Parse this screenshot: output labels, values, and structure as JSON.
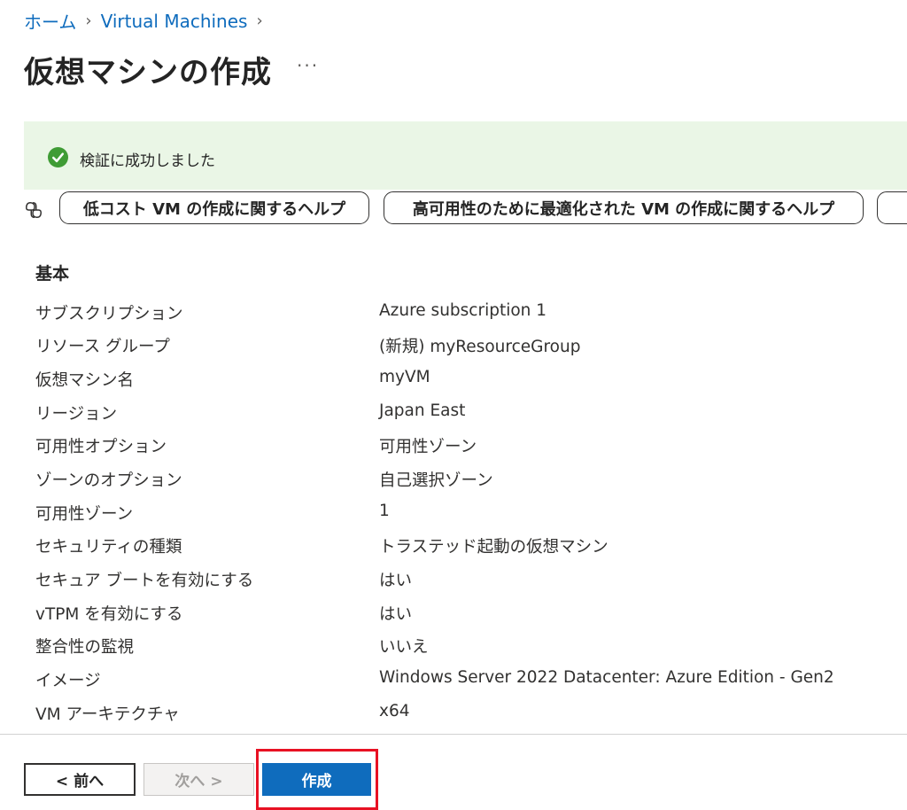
{
  "breadcrumb": {
    "home": "ホーム",
    "vms": "Virtual Machines"
  },
  "page": {
    "title": "仮想マシンの作成"
  },
  "validation": {
    "message": "検証に成功しました",
    "color": "#3f9c35"
  },
  "help_pills": [
    {
      "label": "低コスト VM の作成に関するヘルプ"
    },
    {
      "label": "高可用性のために最適化された VM の作成に関するヘルプ"
    },
    {
      "label": ""
    }
  ],
  "summary": {
    "section_title": "基本",
    "rows": [
      {
        "label": "サブスクリプション",
        "value": "Azure subscription 1"
      },
      {
        "label": "リソース グループ",
        "value": "(新規) myResourceGroup"
      },
      {
        "label": "仮想マシン名",
        "value": "myVM"
      },
      {
        "label": "リージョン",
        "value": "Japan East"
      },
      {
        "label": "可用性オプション",
        "value": "可用性ゾーン"
      },
      {
        "label": "ゾーンのオプション",
        "value": "自己選択ゾーン"
      },
      {
        "label": "可用性ゾーン",
        "value": "1"
      },
      {
        "label": "セキュリティの種類",
        "value": "トラステッド起動の仮想マシン"
      },
      {
        "label": "セキュア ブートを有効にする",
        "value": "はい"
      },
      {
        "label": "vTPM を有効にする",
        "value": "はい"
      },
      {
        "label": "整合性の監視",
        "value": "いいえ"
      },
      {
        "label": "イメージ",
        "value": "Windows Server 2022 Datacenter: Azure Edition - Gen2"
      },
      {
        "label": "VM アーキテクチャ",
        "value": "x64"
      }
    ]
  },
  "footer": {
    "prev_label": "< 前へ",
    "next_label": "次へ >",
    "create_label": "作成"
  },
  "colors": {
    "accent": "#0f6cbd",
    "highlight": "#e81123",
    "banner_bg": "#eaf6e6"
  }
}
